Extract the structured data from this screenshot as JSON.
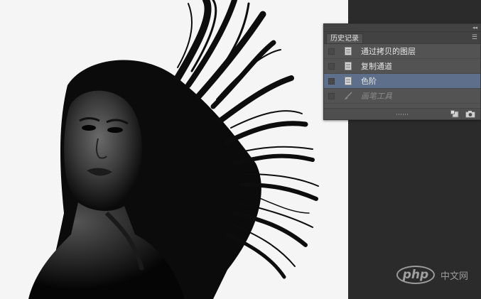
{
  "panel": {
    "tab_label": "历史记录",
    "collapse_icon": "double-chevron-icon",
    "menu_icon": "panel-menu-icon"
  },
  "history": [
    {
      "label": "通过拷贝的图层",
      "state": "past",
      "icon": "document-icon"
    },
    {
      "label": "复制通道",
      "state": "past",
      "icon": "document-icon"
    },
    {
      "label": "色阶",
      "state": "active",
      "icon": "document-icon"
    },
    {
      "label": "画笔工具",
      "state": "future",
      "icon": "brush-icon"
    }
  ],
  "footer": {
    "new_document_icon": "new-document-from-state-icon",
    "snapshot_icon": "camera-icon"
  },
  "watermark": {
    "logo": "php",
    "text": "中文网"
  },
  "colors": {
    "canvas_background": "#f4f4f4",
    "workspace": "#2b2b2b",
    "panel": "#535353",
    "active_row": "#5d6f8b"
  }
}
